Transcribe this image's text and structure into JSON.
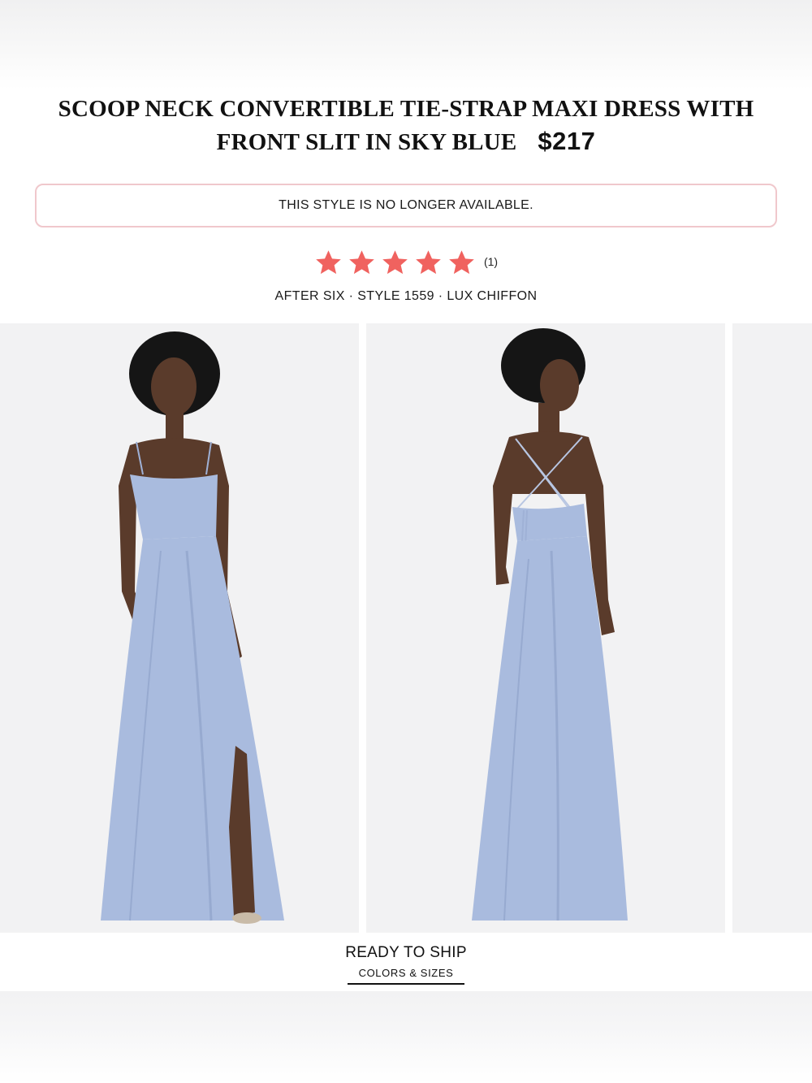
{
  "product": {
    "title": "SCOOP NECK CONVERTIBLE TIE-STRAP MAXI DRESS WITH FRONT SLIT IN SKY BLUE",
    "price": "$217"
  },
  "notice": {
    "text": "THIS STYLE IS NO LONGER AVAILABLE."
  },
  "rating": {
    "stars": 5,
    "star_color": "#f0625f",
    "review_count": "(1)"
  },
  "meta": {
    "text": "AFTER SIX · STYLE 1559 · LUX CHIFFON"
  },
  "gallery": {
    "images": [
      {
        "name": "front-view"
      },
      {
        "name": "back-view"
      },
      {
        "name": "next-view"
      }
    ],
    "dress_color": "#a9bbde"
  },
  "ready_to_ship": {
    "title": "READY TO SHIP",
    "link": "COLORS & SIZES"
  }
}
